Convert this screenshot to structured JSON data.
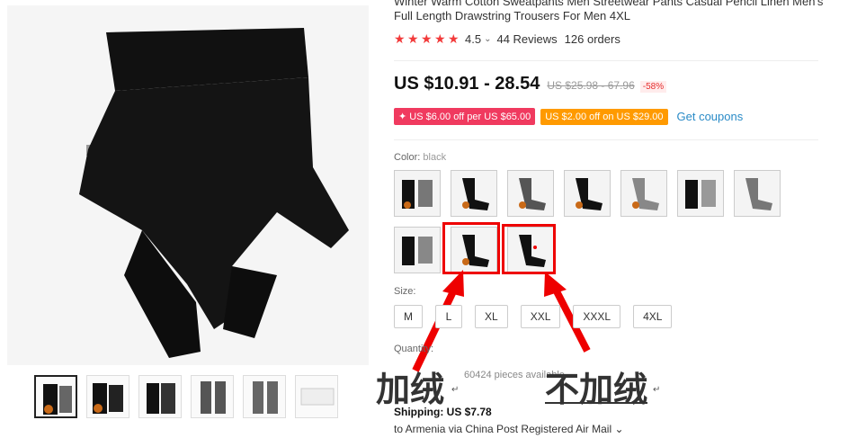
{
  "product": {
    "title": "Winter Warm Cotton Sweatpants Men Streetwear Pants Casual Pencil Linen Men's Full Length Drawstring Trousers For Men 4XL",
    "rating": "4.5",
    "reviews": "44 Reviews",
    "orders": "126 orders",
    "price": "US $10.91 - 28.54",
    "old_price": "US $25.98 - 67.96",
    "discount": "-58%",
    "coupons": [
      {
        "text": "✦ US $6.00 off per US $65.00",
        "color": "#f03a5f"
      },
      {
        "text": "US $2.00 off on US $29.00",
        "color": "#ff9a00"
      }
    ],
    "get_coupons": "Get coupons",
    "color_label": "Color:",
    "color_value": "black",
    "size_label": "Size:",
    "sizes": [
      "M",
      "L",
      "XL",
      "XXL",
      "XXXL",
      "4XL"
    ],
    "quantity_label": "Quantity:",
    "available": "60424 pieces available",
    "shipping_line": "Shipping: US $7.78",
    "shipping_detail": "to Armenia via China Post Registered Air Mail ⌄"
  },
  "annotation": {
    "left_text": "加绒",
    "right_text": "不加绒",
    "para_mark": "↵",
    "accent_color": "#e00000"
  }
}
